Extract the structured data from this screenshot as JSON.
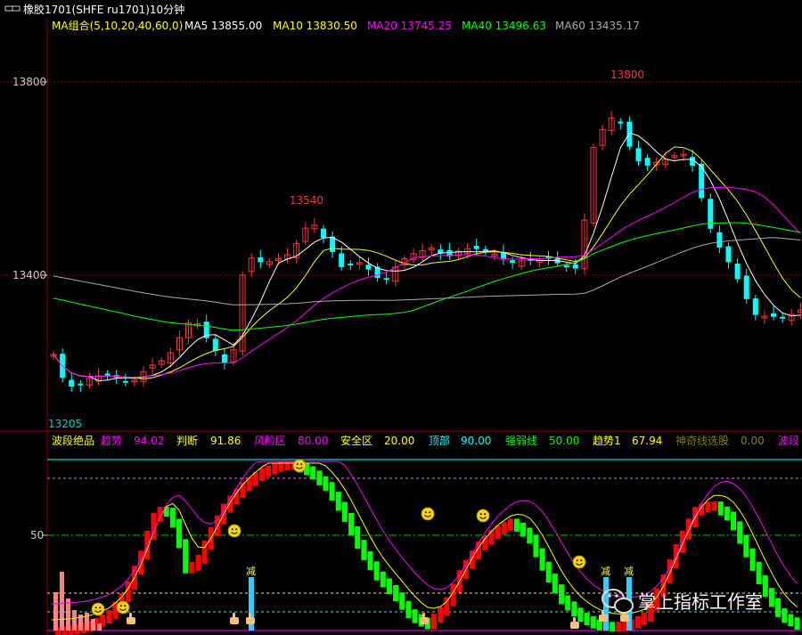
{
  "window": {
    "title": "橡胶1701(SHFE ru1701)10分钟",
    "title_icon": "window-menu-icon"
  },
  "main_legend": {
    "group_label": "MA组合(5,10,20,40,60,0)",
    "items": [
      {
        "label": "MA5 13855.00",
        "color": "#ffffff"
      },
      {
        "label": "MA10 13830.50",
        "color": "#ffff00"
      },
      {
        "label": "MA20 13745.25",
        "color": "#ff00ff"
      },
      {
        "label": "MA40 13496.63",
        "color": "#00ff00"
      },
      {
        "label": "MA60 13435.17",
        "color": "#aaaaaa"
      }
    ]
  },
  "price_axis": {
    "labels": [
      "13800",
      "13400"
    ],
    "low_marker": "13205"
  },
  "annotations": {
    "peak_1": "13540",
    "peak_2": "13800"
  },
  "indicator_legend": {
    "name": "波段绝品",
    "items": [
      {
        "label": "趋势",
        "value": "94.02",
        "color": "#ff00ff"
      },
      {
        "label": "判断",
        "value": "91.86",
        "color": "#ffff00"
      },
      {
        "label": "风险区",
        "value": "80.00",
        "color": "#ff00ff"
      },
      {
        "label": "安全区",
        "value": "20.00",
        "color": "#ffff00"
      },
      {
        "label": "顶部",
        "value": "90.00",
        "color": "#00ffff"
      },
      {
        "label": "强弱线",
        "value": "50.00",
        "color": "#00ff00"
      },
      {
        "label": "趋势1",
        "value": "67.94",
        "color": "#ffff00"
      },
      {
        "label": "神奇线选股",
        "value": "0.00",
        "color": "#808000"
      },
      {
        "label": "波段",
        "value": "",
        "color": "#ff00ff"
      }
    ],
    "axis_label": "50",
    "markers": {
      "reduce": "减",
      "low": "低"
    }
  },
  "watermark": {
    "text": "掌上指标工作室"
  },
  "colors": {
    "up": "#ff3232",
    "down": "#00ffff",
    "grid": "#8b0000",
    "ind_up": "#ff0000",
    "ind_down": "#00ff00"
  }
}
